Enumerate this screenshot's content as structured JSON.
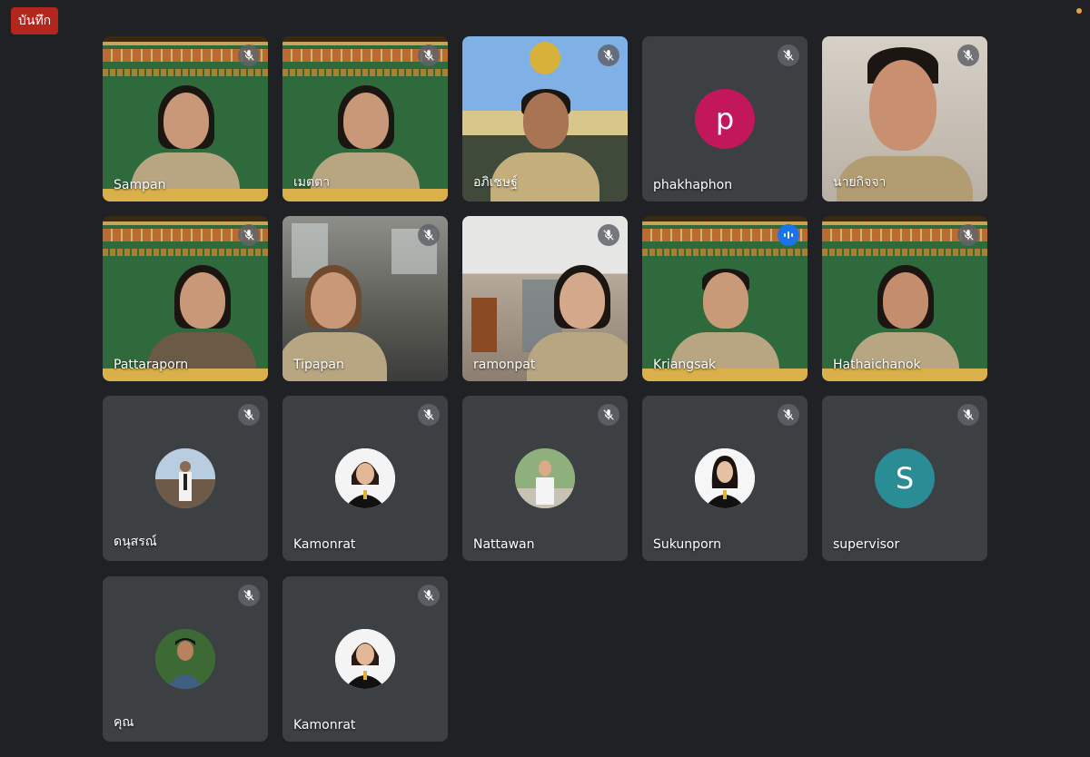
{
  "recording_badge": "บันทึก",
  "colors": {
    "page_bg": "#202124",
    "tile_bg": "#3c4043",
    "record": "#b3261e",
    "speaking": "#1a73e8"
  },
  "participants": [
    {
      "name": "Sampan",
      "video": true,
      "muted": true
    },
    {
      "name": "เมตตา",
      "video": true,
      "muted": true
    },
    {
      "name": "อภิเชษฐ์",
      "video": true,
      "muted": true
    },
    {
      "name": "phakhaphon",
      "video": false,
      "muted": true,
      "initial": "p",
      "avatar_color": "#c2185b"
    },
    {
      "name": "นายกิจจา",
      "video": true,
      "muted": true
    },
    {
      "name": "Pattaraporn",
      "video": true,
      "muted": true
    },
    {
      "name": "Tipapan",
      "video": true,
      "muted": true
    },
    {
      "name": "ramonpat",
      "video": true,
      "muted": true
    },
    {
      "name": "Kriangsak",
      "video": true,
      "muted": false,
      "speaking": true
    },
    {
      "name": "Hathaichanok",
      "video": true,
      "muted": true
    },
    {
      "name": "ดนุสรณ์",
      "video": false,
      "muted": true
    },
    {
      "name": "Kamonrat",
      "video": false,
      "muted": true
    },
    {
      "name": "Nattawan",
      "video": false,
      "muted": true
    },
    {
      "name": "Sukunporn",
      "video": false,
      "muted": true
    },
    {
      "name": "supervisor",
      "video": false,
      "muted": true,
      "initial": "S",
      "avatar_color": "#2a8c94"
    },
    {
      "name": "คุณ",
      "video": false,
      "muted": true
    },
    {
      "name": "Kamonrat",
      "video": false,
      "muted": true
    }
  ],
  "icons": {
    "mute": "mic-off-icon",
    "speaking": "audio-level-icon"
  }
}
